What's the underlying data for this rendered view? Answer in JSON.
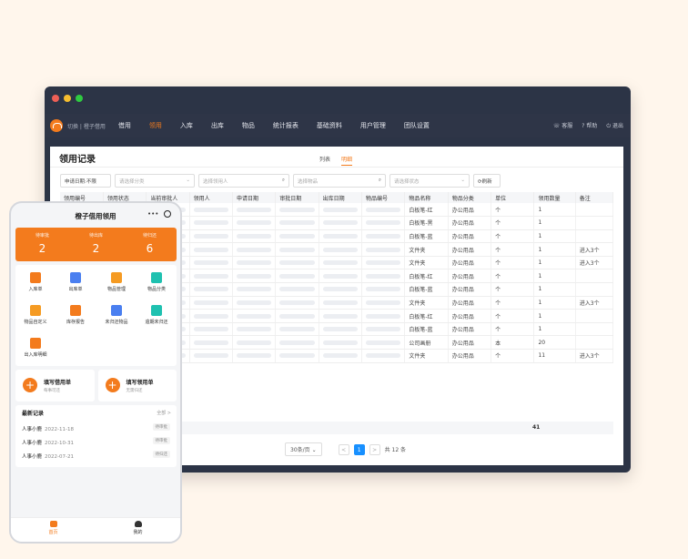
{
  "colors": {
    "accent": "#f37b1d",
    "pager_active": "#1890ff"
  },
  "window": {
    "dots": [
      "#ed5f56",
      "#f5bd2f",
      "#2fca41"
    ]
  },
  "nav": {
    "brand": "切换 | 橙子借用",
    "items": [
      "借用",
      "领用",
      "入库",
      "出库",
      "物品",
      "统计报表",
      "基础资料",
      "用户管理",
      "团队设置"
    ],
    "active_index": 1,
    "right": [
      "客服",
      "帮助",
      "退出"
    ]
  },
  "panel": {
    "title": "领用记录",
    "tabs": [
      "列表",
      "明细"
    ],
    "active_tab": 1
  },
  "filters": {
    "date": "申请日期:不限",
    "category": "请选择分类",
    "receiver": "选择领用人",
    "item": "选择物品",
    "status": "请选择状态",
    "refresh": "刷新"
  },
  "table": {
    "headers": [
      "领用编号",
      "领用状态",
      "当前审批人",
      "领用人",
      "申请日期",
      "审批日期",
      "出库日期",
      "物品编号",
      "物品名称",
      "物品分类",
      "单位",
      "领用数量",
      "备注"
    ],
    "rows": [
      {
        "name": "白板笔-红",
        "cat": "办公用品",
        "unit": "个",
        "qty": "1",
        "note": ""
      },
      {
        "name": "白板笔-黑",
        "cat": "办公用品",
        "unit": "个",
        "qty": "1",
        "note": ""
      },
      {
        "name": "白板笔-蓝",
        "cat": "办公用品",
        "unit": "个",
        "qty": "1",
        "note": ""
      },
      {
        "name": "文件夹",
        "cat": "办公用品",
        "unit": "个",
        "qty": "1",
        "note": "进入3个"
      },
      {
        "name": "文件夹",
        "cat": "办公用品",
        "unit": "个",
        "qty": "1",
        "note": "进入3个"
      },
      {
        "name": "白板笔-红",
        "cat": "办公用品",
        "unit": "个",
        "qty": "1",
        "note": ""
      },
      {
        "name": "白板笔-蓝",
        "cat": "办公用品",
        "unit": "个",
        "qty": "1",
        "note": ""
      },
      {
        "name": "文件夹",
        "cat": "办公用品",
        "unit": "个",
        "qty": "1",
        "note": "进入3个"
      },
      {
        "name": "白板笔-红",
        "cat": "办公用品",
        "unit": "个",
        "qty": "1",
        "note": ""
      },
      {
        "name": "白板笔-蓝",
        "cat": "办公用品",
        "unit": "个",
        "qty": "1",
        "note": ""
      },
      {
        "name": "公司画册",
        "cat": "办公用品",
        "unit": "本",
        "qty": "20",
        "note": ""
      },
      {
        "name": "文件夹",
        "cat": "办公用品",
        "unit": "个",
        "qty": "11",
        "note": "进入3个"
      }
    ],
    "total": "41"
  },
  "pager": {
    "size": "30条/页",
    "page": "1",
    "total": "共 12 条",
    "prev": "<",
    "next": ">"
  },
  "phone": {
    "title": "橙子借用领用",
    "more": "•••",
    "stats": [
      {
        "label": "待审批",
        "value": "2"
      },
      {
        "label": "待出库",
        "value": "2"
      },
      {
        "label": "待归还",
        "value": "6"
      }
    ],
    "grid": [
      {
        "label": "入库单",
        "color": "#f37b1d"
      },
      {
        "label": "出库单",
        "color": "#4a7ff0"
      },
      {
        "label": "物品管理",
        "color": "#f59b23"
      },
      {
        "label": "物品分类",
        "color": "#1fc1b0"
      },
      {
        "label": "物品自定义",
        "color": "#f59b23"
      },
      {
        "label": "库存报告",
        "color": "#f37b1d"
      },
      {
        "label": "未归还物品",
        "color": "#4a7ff0"
      },
      {
        "label": "逾期未归还",
        "color": "#1fc1b0"
      },
      {
        "label": "出入库明细",
        "color": "#f37b1d"
      }
    ],
    "cards": [
      {
        "title": "填写借用单",
        "sub": "每事可还"
      },
      {
        "title": "填写领用单",
        "sub": "无需归还"
      }
    ],
    "recent": {
      "title": "最新记录",
      "more": "全部 >",
      "rows": [
        {
          "name": "人事小鹿",
          "date": "2022-11-18",
          "badge": "待审批"
        },
        {
          "name": "人事小鹿",
          "date": "2022-10-31",
          "badge": "待审批"
        },
        {
          "name": "人事小鹿",
          "date": "2022-07-21",
          "badge": "待归还"
        }
      ]
    },
    "tabs": [
      "首页",
      "我的"
    ]
  }
}
